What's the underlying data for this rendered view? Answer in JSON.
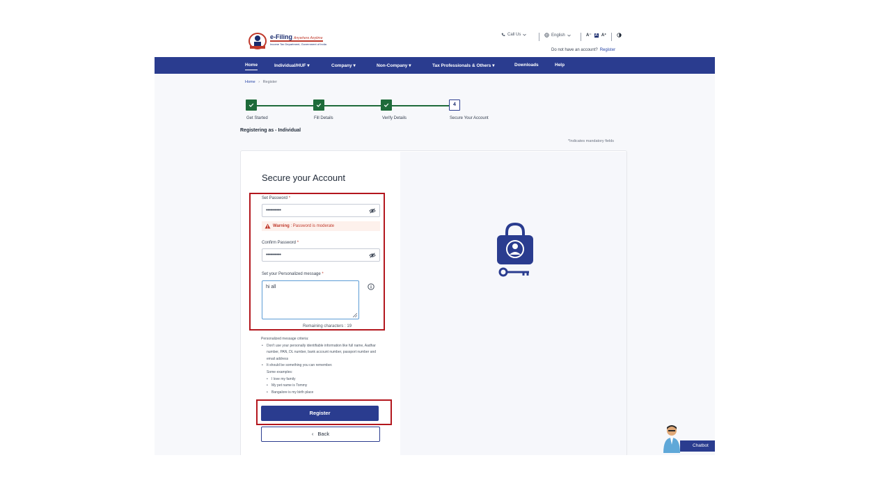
{
  "header": {
    "brand": "e-Filing",
    "brand_tagline": "Anywhere Anytime",
    "brand_sub": "Income Tax Department, Government of India",
    "call_us": "Call Us",
    "language": "English",
    "font_small": "A⁻",
    "font_normal": "A",
    "font_large": "A⁺",
    "no_account_text": "Do not have an account?",
    "register_link": "Register"
  },
  "nav": {
    "items": [
      "Home",
      "Individual/HUF",
      "Company",
      "Non-Company",
      "Tax Professionals & Others",
      "Downloads",
      "Help"
    ]
  },
  "breadcrumb": {
    "home": "Home",
    "separator": "›",
    "current": "Register"
  },
  "stepper": {
    "steps": [
      {
        "label": "Get Started",
        "status": "done"
      },
      {
        "label": "Fill Details",
        "status": "done"
      },
      {
        "label": "Verify Details",
        "status": "done"
      },
      {
        "label": "Secure Your Account",
        "status": "current",
        "number": "4"
      }
    ]
  },
  "registering_as": "Registering as - Individual",
  "mandatory_note": "*Indicates mandatory fields",
  "form": {
    "title": "Secure your Account",
    "set_password_label": "Set Password",
    "set_password_value": "•••••••••••",
    "warning_label": "Warning",
    "warning_text": ": Password is moderate",
    "confirm_password_label": "Confirm Password",
    "confirm_password_value": "•••••••••••",
    "message_label": "Set your Personalized message",
    "message_value": "hi all",
    "required_mark": "*",
    "remaining": "Remaining characters : 19"
  },
  "criteria": {
    "title": "Personalized message criteria:",
    "rule1": "Don't use your personally identifiable information like full name, Aadhar number, PAN, DL number, bank account number, passport number and email address",
    "rule2": "It should be something you can remember.",
    "examples_title": "Some examples:",
    "examples": [
      "I love my family",
      "My pet name is Tommy",
      "Bangalore is my birth place"
    ]
  },
  "buttons": {
    "register": "Register",
    "back": "Back"
  },
  "chatbot": {
    "label": "Chatbot"
  },
  "colors": {
    "primary": "#2a3c8f",
    "success": "#1e6b3a",
    "highlight": "#b3161d",
    "warning": "#c0392b"
  }
}
